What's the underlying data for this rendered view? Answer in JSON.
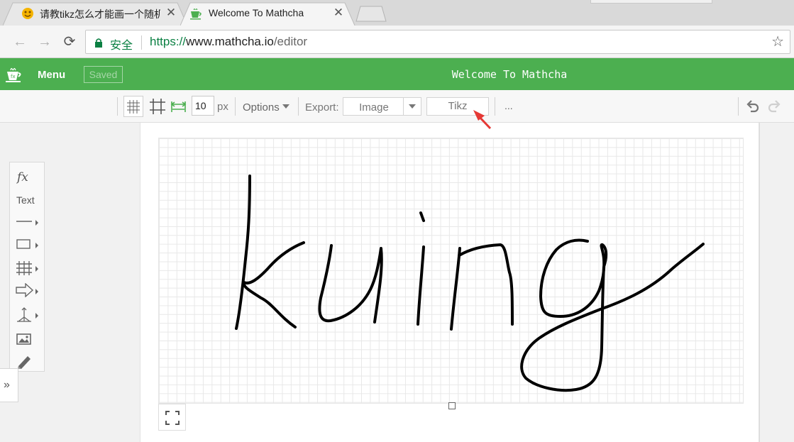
{
  "browser": {
    "tabs": [
      {
        "title": "请教tikz怎么才能画一个随机",
        "favicon": "kuing-face-icon",
        "active": false
      },
      {
        "title": "Welcome To Mathcha",
        "favicon": "mathcha-teacup-icon",
        "active": true
      }
    ],
    "nav": {
      "back": "←",
      "forward": "→",
      "reload": "⟳"
    },
    "address": {
      "secure_label": "安全",
      "scheme": "https://",
      "host": "www.mathcha.io",
      "path": "/editor"
    },
    "bookmark_star": "☆"
  },
  "app": {
    "menu_label": "Menu",
    "saved_label": "Saved",
    "document_title": "Welcome To Mathcha",
    "brand_color": "#4caf50"
  },
  "toolbar": {
    "grid_size_value": "10",
    "grid_unit": "px",
    "options_label": "Options",
    "export_label": "Export:",
    "export_image_label": "Image",
    "export_tikz_label": "Tikz",
    "more_label": "..."
  },
  "palette": {
    "fx_label": "fx",
    "text_label": "Text",
    "expand_label": "»",
    "tools": [
      "line-tool",
      "rectangle-tool",
      "grid-tool",
      "arrow-tool",
      "axes-tool",
      "image-tool",
      "pencil-tool"
    ]
  },
  "canvas": {
    "handwriting": "kuing",
    "stroke_color": "#000000",
    "annotation_arrow_color": "#e53935"
  }
}
